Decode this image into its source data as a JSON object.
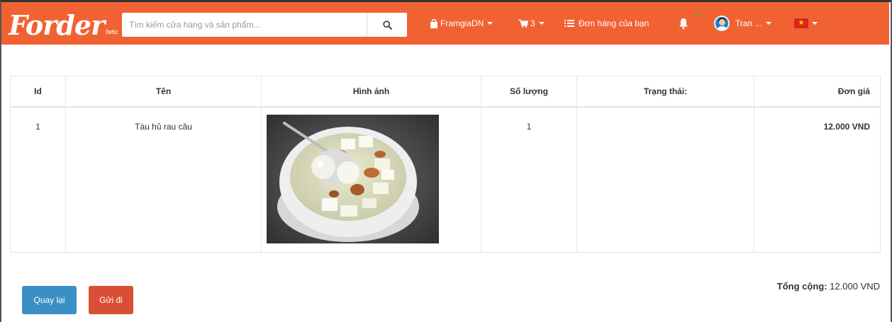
{
  "navbar": {
    "brand": "Forder",
    "brand_tag": "beta",
    "search_placeholder": "Tìm kiếm cửa hàng và sản phẩm...",
    "store_label": "FramgiaDN",
    "cart_count": "3",
    "orders_label": "Đơn hàng của bạn",
    "user_label": "Tran ...",
    "colors": {
      "bar": "#f16233"
    }
  },
  "table": {
    "headers": [
      "Id",
      "Tên",
      "Hình ảnh",
      "Số lượng",
      "Trạng thái:",
      "Đơn giá"
    ],
    "rows": [
      {
        "id": "1",
        "name": "Tàu hủ rau câu",
        "quantity": "1",
        "status": "",
        "price": "12.000 VND"
      }
    ]
  },
  "buttons": {
    "back": "Quay lại",
    "send": "Gửi đi"
  },
  "summary": {
    "total_label": "Tổng cộng:",
    "total_value": "12.000 VND"
  }
}
